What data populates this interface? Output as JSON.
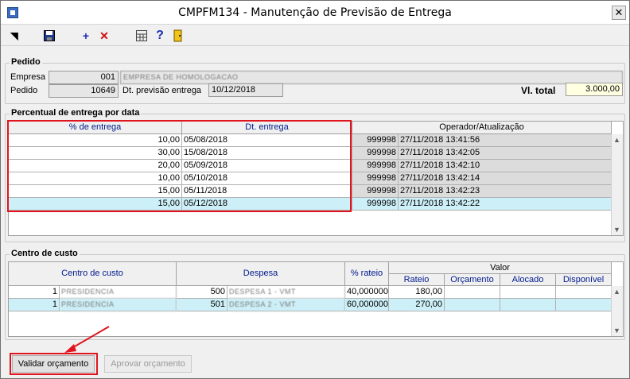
{
  "window": {
    "title": "CMPFM134 - Manutenção de Previsão de Entrega"
  },
  "pedido": {
    "group_title": "Pedido",
    "empresa_label": "Empresa",
    "empresa_code": "001",
    "empresa_name": "EMPRESA DE HOMOLOGACAO",
    "pedido_label": "Pedido",
    "pedido_number": "10649",
    "dt_prev_label": "Dt. previsão entrega",
    "dt_prev_value": "10/12/2018",
    "vl_total_label": "Vl. total",
    "vl_total_value": "3.000,00"
  },
  "percentual": {
    "group_title": "Percentual de entrega por data",
    "col_perc": "% de entrega",
    "col_dt": "Dt. entrega",
    "col_oper": "Operador/Atualização",
    "rows": [
      {
        "perc": "10,00",
        "dt": "05/08/2018",
        "oper": "999998",
        "atual": "27/11/2018 13:41:56"
      },
      {
        "perc": "30,00",
        "dt": "15/08/2018",
        "oper": "999998",
        "atual": "27/11/2018 13:42:05"
      },
      {
        "perc": "20,00",
        "dt": "05/09/2018",
        "oper": "999998",
        "atual": "27/11/2018 13:42:10"
      },
      {
        "perc": "10,00",
        "dt": "05/10/2018",
        "oper": "999998",
        "atual": "27/11/2018 13:42:14"
      },
      {
        "perc": "15,00",
        "dt": "05/11/2018",
        "oper": "999998",
        "atual": "27/11/2018 13:42:23"
      },
      {
        "perc": "15,00",
        "dt": "05/12/2018",
        "oper": "999998",
        "atual": "27/11/2018 13:42:22"
      }
    ]
  },
  "centro": {
    "group_title": "Centro de custo",
    "col_centro": "Centro de custo",
    "col_despesa": "Despesa",
    "col_rateio_pct": "% rateio",
    "col_valor": "Valor",
    "col_rateio": "Rateio",
    "col_orcamento": "Orçamento",
    "col_alocado": "Alocado",
    "col_disponivel": "Disponível",
    "rows": [
      {
        "cc_code": "1",
        "cc_name": "PRESIDENCIA",
        "desp_code": "500",
        "desp_name": "DESPESA 1 - VMT",
        "pct": "40,000000",
        "rateio": "180,00",
        "orcamento": "",
        "alocado": "",
        "disponivel": ""
      },
      {
        "cc_code": "1",
        "cc_name": "PRESIDENCIA",
        "desp_code": "501",
        "desp_name": "DESPESA 2 - VMT",
        "pct": "60,000000",
        "rateio": "270,00",
        "orcamento": "",
        "alocado": "",
        "disponivel": ""
      }
    ]
  },
  "buttons": {
    "validar": "Validar orçamento",
    "aprovar": "Aprovar orçamento"
  },
  "colors": {
    "highlight": "#e0141e",
    "selected_row": "#cdeff7",
    "total_field": "#ffffe1"
  }
}
